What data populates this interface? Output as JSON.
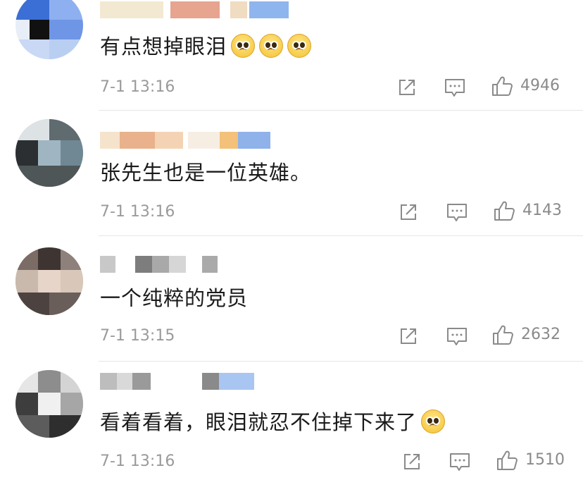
{
  "comments": [
    {
      "text": "有点想掉眼泪",
      "emoji_count": 3,
      "time": "7-1 13:16",
      "likes": "4946"
    },
    {
      "text": "张先生也是一位英雄。",
      "emoji_count": 0,
      "time": "7-1 13:16",
      "likes": "4143"
    },
    {
      "text": "一个纯粹的党员",
      "emoji_count": 0,
      "time": "7-1 13:15",
      "likes": "2632"
    },
    {
      "text": "看着看着，眼泪就忍不住掉下来了",
      "emoji_count": 1,
      "time": "7-1 13:16",
      "likes": "1510"
    }
  ],
  "icons": {
    "share": "share-icon",
    "reply": "comment-icon",
    "like": "thumbs-up-icon"
  },
  "colors": {
    "text": "#1a1a1a",
    "meta": "#9a9a9a",
    "icon": "#8a8a8a",
    "divider": "#e6e6e6"
  }
}
